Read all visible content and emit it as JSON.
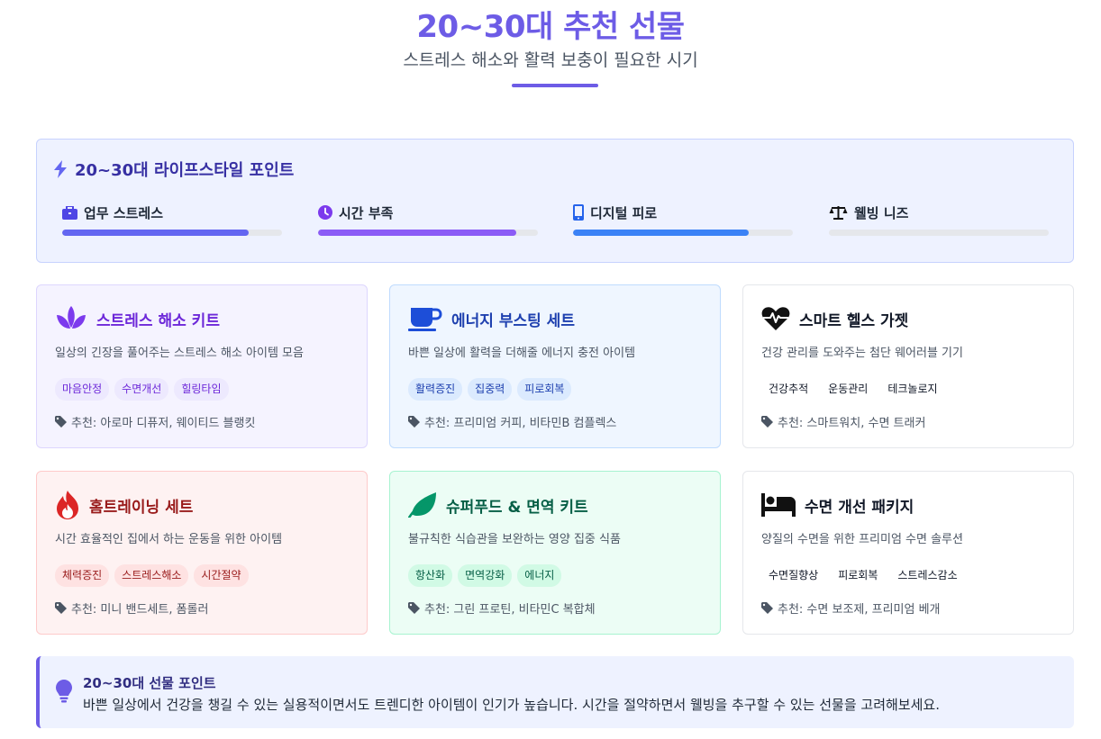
{
  "header": {
    "title": "20~30대 추천 선물",
    "subtitle": "스트레스 해소와 활력 보충이 필요한 시기"
  },
  "lifestyle": {
    "title": "20~30대 라이프스타일 포인트",
    "icon": "bolt-icon",
    "metrics": [
      {
        "label": "업무 스트레스",
        "icon": "briefcase-icon",
        "level": 0.85,
        "color": "#6366f1"
      },
      {
        "label": "시간 부족",
        "icon": "clock-icon",
        "level": 0.9,
        "color": "#8b5cf6"
      },
      {
        "label": "디지털 피로",
        "icon": "mobile-icon",
        "level": 0.8,
        "color": "#3b82f6"
      },
      {
        "label": "웰빙 니즈",
        "icon": "scale-icon",
        "level": 0,
        "color": "#e5e7eb"
      }
    ]
  },
  "cards": [
    {
      "title": "스트레스 해소 키트",
      "icon": "lotus-icon",
      "desc": "일상의 긴장을 풀어주는 스트레스 해소 아이템 모음",
      "tags": [
        "마음안정",
        "수면개선",
        "힐링타임"
      ],
      "rec": "추천: 아로마 디퓨저, 웨이티드 블랭킷",
      "bg": "#f5f3ff",
      "border": "#ddd6fe",
      "title_color": "#6d28d9",
      "icon_color": "#7c3aed",
      "tag_bg": "#ede9fe",
      "tag_color": "#6d28d9"
    },
    {
      "title": "에너지 부스팅 세트",
      "icon": "coffee-cup-icon",
      "desc": "바쁜 일상에 활력을 더해줄 에너지 충전 아이템",
      "tags": [
        "활력증진",
        "집중력",
        "피로회복"
      ],
      "rec": "추천: 프리미엄 커피, 비타민B 컴플렉스",
      "bg": "#eff6ff",
      "border": "#bfdbfe",
      "title_color": "#1e40af",
      "icon_color": "#1d4ed8",
      "tag_bg": "#dbeafe",
      "tag_color": "#1e40af"
    },
    {
      "title": "스마트 헬스 가젯",
      "icon": "heartbeat-icon",
      "desc": "건강 관리를 도와주는 첨단 웨어러블 기기",
      "tags": [
        "건강추적",
        "운동관리",
        "테크놀로지"
      ],
      "rec": "추천: 스마트워치, 수면 트래커",
      "bg": "#ffffff",
      "border": "#e5e7eb",
      "title_color": "#111827",
      "icon_color": "#111111",
      "tag_bg": "#ffffff",
      "tag_color": "#111827"
    },
    {
      "title": "홈트레이닝 세트",
      "icon": "fire-icon",
      "desc": "시간 효율적인 집에서 하는 운동을 위한 아이템",
      "tags": [
        "체력증진",
        "스트레스해소",
        "시간절약"
      ],
      "rec": "추천: 미니 밴드세트, 폼롤러",
      "bg": "#fef2f2",
      "border": "#fecaca",
      "title_color": "#991b1b",
      "icon_color": "#dc2626",
      "tag_bg": "#fee2e2",
      "tag_color": "#991b1b"
    },
    {
      "title": "슈퍼푸드 & 면역 키트",
      "icon": "leaf-icon",
      "desc": "불규칙한 식습관을 보완하는 영양 집중 식품",
      "tags": [
        "항산화",
        "면역강화",
        "에너지"
      ],
      "rec": "추천: 그린 프로틴, 비타민C 복합체",
      "bg": "#ecfdf5",
      "border": "#a7f3d0",
      "title_color": "#065f46",
      "icon_color": "#059669",
      "tag_bg": "#d1fae5",
      "tag_color": "#065f46"
    },
    {
      "title": "수면 개선 패키지",
      "icon": "bed-icon",
      "desc": "양질의 수면을 위한 프리미엄 수면 솔루션",
      "tags": [
        "수면질향상",
        "피로회복",
        "스트레스감소"
      ],
      "rec": "추천: 수면 보조제, 프리미엄 베개",
      "bg": "#ffffff",
      "border": "#e5e7eb",
      "title_color": "#111827",
      "icon_color": "#111111",
      "tag_bg": "#ffffff",
      "tag_color": "#111827"
    }
  ],
  "tip": {
    "icon": "lightbulb-icon",
    "title": "20~30대 선물 포인트",
    "text": "바쁜 일상에서 건강을 챙길 수 있는 실용적이면서도 트렌디한 아이템이 인기가 높습니다. 시간을 절약하면서 웰빙을 추구할 수 있는 선물을 고려해보세요."
  }
}
